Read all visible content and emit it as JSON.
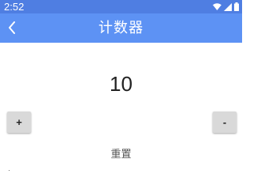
{
  "status_bar": {
    "time": "2:52",
    "icons": [
      "wifi-icon",
      "cellular-signal-icon",
      "battery-icon"
    ],
    "color": "#4f7ee2"
  },
  "app_bar": {
    "title": "计数器",
    "back_icon": "chevron-left-icon",
    "color": "#5d92f4"
  },
  "counter": {
    "value": "10"
  },
  "buttons": {
    "increment_label": "+",
    "decrement_label": "-",
    "reset_label": "重置"
  }
}
